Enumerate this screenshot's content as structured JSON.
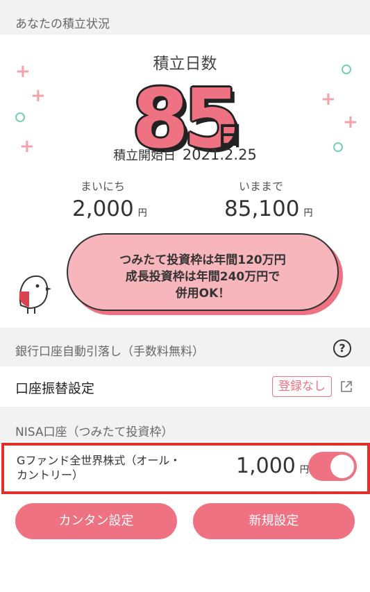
{
  "status_section": {
    "header": "あなたの積立状況",
    "days_label": "積立日数",
    "days_value": "85",
    "days_unit": "日",
    "start_label": "積立開始日",
    "start_date": "2021.2.25",
    "daily_label": "まいにち",
    "daily_amount": "2,000",
    "total_label": "いままで",
    "total_amount": "85,100",
    "yen_unit": "円",
    "bubble_lines": [
      "つみたて投資枠は年間120万円",
      "成長投資枠は年間240万円で",
      "併用OK！"
    ]
  },
  "bank_section": {
    "header": "銀行口座自動引落し（手数料無料）",
    "help_icon": "?",
    "transfer_label": "口座振替設定",
    "transfer_status": "登録なし"
  },
  "nisa_section": {
    "header": "NISA口座（つみたて投資枠）",
    "fund_name": "Gファンド全世界株式（オール・カントリー）",
    "fund_amount": "1,000",
    "fund_toggle_on": true
  },
  "buttons": {
    "easy_setup": "カンタン設定",
    "new_setup": "新規設定"
  },
  "colors": {
    "accent": "#ee7282",
    "highlight_border": "#e0302a",
    "mint": "#78cfb0"
  }
}
